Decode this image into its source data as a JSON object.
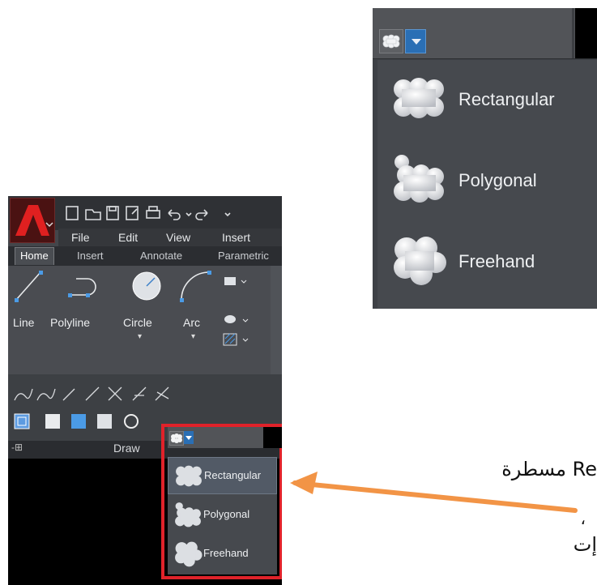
{
  "inset": {
    "cloud_button_icon": "revcloud-icon",
    "dropdown_icon": "chevron-down-icon",
    "menu_items": [
      {
        "label": "Rectangular",
        "icon": "rectangular-cloud-icon"
      },
      {
        "label": "Polygonal",
        "icon": "polygonal-cloud-icon"
      },
      {
        "label": "Freehand",
        "icon": "freehand-cloud-icon"
      }
    ]
  },
  "autocad": {
    "app_logo": "autocad-a-logo",
    "quick_access_icons": [
      "new-icon",
      "open-icon",
      "save-icon",
      "save-as-icon",
      "print-icon",
      "undo-icon",
      "redo-icon"
    ],
    "menubar": [
      "File",
      "Edit",
      "View",
      "Insert"
    ],
    "ribbon_tabs": [
      "Home",
      "Insert",
      "Annotate",
      "Parametric"
    ],
    "active_tab": "Home",
    "draw_tools": [
      {
        "label": "Line",
        "icon": "line-icon"
      },
      {
        "label": "Polyline",
        "icon": "polyline-icon"
      },
      {
        "label": "Circle",
        "icon": "circle-icon"
      },
      {
        "label": "Arc",
        "icon": "arc-icon"
      }
    ],
    "panel_label": "Draw",
    "revcloud_menu": [
      {
        "label": "Rectangular",
        "icon": "rectangular-cloud-icon"
      },
      {
        "label": "Polygonal",
        "icon": "polygonal-cloud-icon"
      },
      {
        "label": "Freehand",
        "icon": "freehand-cloud-icon"
      }
    ]
  },
  "annotation": {
    "arrow_color": "#f29446",
    "arabic_line1": "Re مسطرة",
    "arabic_line2": "إت"
  },
  "colors": {
    "highlight_border": "#e0222a",
    "ui_dark": "#43464b",
    "accent_blue": "#2a6fb5"
  }
}
